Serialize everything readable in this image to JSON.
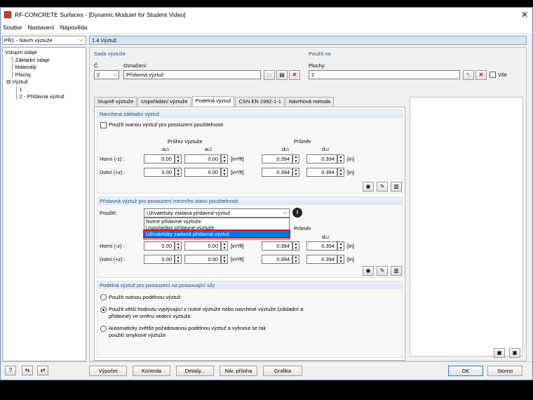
{
  "window": {
    "title": "RF-CONCRETE Surfaces - [Dynamic ModuleI for Student Video]",
    "close": "✕"
  },
  "menu": [
    "Soubor",
    "Nastavení",
    "Nápověda"
  ],
  "left": {
    "combo": "PŘ1 - Návrh výztuže",
    "tree": [
      "Vstupní údaje",
      "Základní údaje",
      "Materiály",
      "Plochy",
      "Výztuž",
      "1",
      "2 - Přídavná výztuž"
    ]
  },
  "panel_title": "1.4 Výztuž",
  "sada": {
    "header": "Sada výztuže",
    "c_label": "Č.",
    "c_value": "2",
    "oznaceni_label": "Označení:",
    "oznaceni_value": "Přídavná výztuž"
  },
  "pouzit_na": {
    "header": "Použít na",
    "plochy_label": "Plochy:",
    "plochy_value": "2",
    "vse_label": "Vše"
  },
  "tabs": [
    "Stupně výztuže",
    "Uspořádání výztuže",
    "Podélná výztuž",
    "CSN EN 1992-1-1",
    "Návrhová metoda"
  ],
  "navrzena": {
    "header": "Navržená základní výztuž",
    "checkbox": "Použít nutnou výztuž pro posouzení použitelnosti",
    "prurez": "Průřez výztuže",
    "prumer": "Průměr",
    "col_a1": "a",
    "col_a1_sub": "s1",
    "col_a2": "a",
    "col_a2_sub": "s2",
    "col_d1": "d",
    "col_d1_sub": "s1",
    "col_d2": "d",
    "col_d2_sub": "s2",
    "rows": [
      {
        "label": "Horní (-z) :",
        "a1": "0.00",
        "a2": "0.00",
        "unit_a": "[in²/ft]",
        "d1": "0.394",
        "d2": "0.394",
        "unit_d": "[in]"
      },
      {
        "label": "Dolní (+z) :",
        "a1": "0.00",
        "a2": "0.00",
        "unit_a": "[in²/ft]",
        "d1": "0.394",
        "d2": "0.394",
        "unit_d": "[in]"
      }
    ]
  },
  "pridavna": {
    "header": "Přídavná výztuž pro posouzení mezního stavu použitelnosti",
    "pouziti_label": "Použití:",
    "pouziti_value": "Uživatelsky zadaná přídavná výztuž",
    "options": [
      "Nutné přídavné výztuže",
      "Uspořádání přídavné výztuže",
      "Uživatelsky zadaná přídavná výztuž"
    ],
    "prumer": "Průměr",
    "col_d2": "d",
    "col_d2_sub": "s2",
    "rows": [
      {
        "label": "Horní (-z) :",
        "a1": "0.00",
        "a2": "0.00",
        "unit_a": "[in²/ft]",
        "d1": "0.394",
        "d2": "0.394",
        "unit_d": "[in]"
      },
      {
        "label": "Dolní (+z) :",
        "a1": "0.00",
        "a2": "0.00",
        "unit_a": "[in²/ft]",
        "d1": "0.394",
        "d2": "0.394",
        "unit_d": "[in]"
      }
    ]
  },
  "podelna": {
    "header": "Podélná výztuž pro posouzení na posouvající síly",
    "opt1": "Použít nutnou podélnou výztuž",
    "opt2_line1": "Použít větší hodnotu vyplývající z nutné výztuže nebo navržené výztuže (základní a",
    "opt2_line2": "přídavné) ve směru vedení výztuže.",
    "opt3_line1": "Automaticky zvětšit požadovanou podélnou výztuž a vyhnout se tak",
    "opt3_line2": "použití smykové výztuže"
  },
  "buttons": {
    "vypocet": "Výpočet",
    "kontrola": "Kontrola",
    "detaily": "Detaily...",
    "nar_priloha": "Nár. příloha",
    "grafika": "Grafika",
    "ok": "OK",
    "storno": "Storno"
  }
}
